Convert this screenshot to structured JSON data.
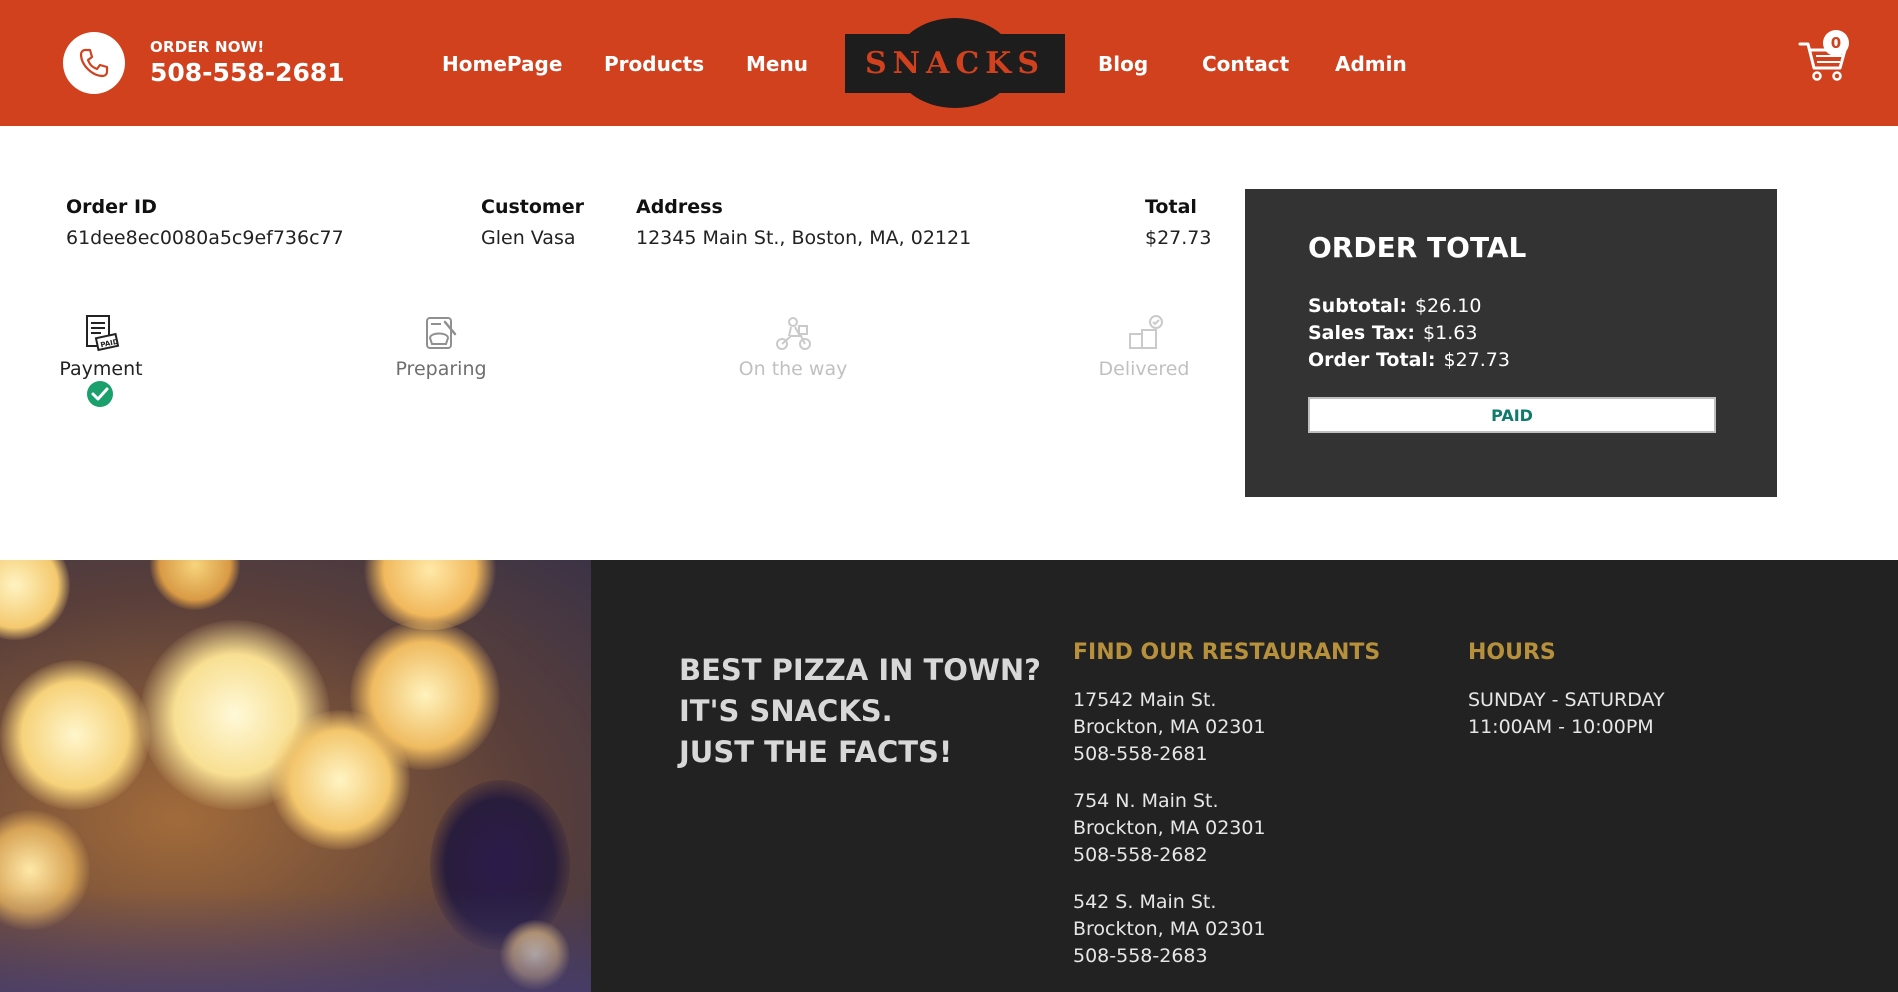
{
  "header": {
    "order_now": "ORDER NOW!",
    "phone": "508-558-2681",
    "nav_left": [
      "HomePage",
      "Products",
      "Menu"
    ],
    "logo": "SNACKS",
    "nav_right": [
      "Blog",
      "Contact",
      "Admin"
    ],
    "cart_count": "0",
    "brand_color": "#d1411e"
  },
  "order": {
    "headers": {
      "id": "Order ID",
      "customer": "Customer",
      "address": "Address",
      "total": "Total"
    },
    "id": "61dee8ec0080a5c9ef736c77",
    "customer": "Glen Vasa",
    "address": "12345 Main St., Boston, MA, 02121",
    "total": "$27.73"
  },
  "statuses": [
    {
      "label": "Payment",
      "icon": "paid-receipt-icon",
      "state": "done"
    },
    {
      "label": "Preparing",
      "icon": "chef-pot-icon",
      "state": "inprogress"
    },
    {
      "label": "On the way",
      "icon": "delivery-scooter-icon",
      "state": "undone"
    },
    {
      "label": "Delivered",
      "icon": "delivered-box-icon",
      "state": "undone"
    }
  ],
  "summary": {
    "title": "ORDER TOTAL",
    "subtotal_label": "Subtotal:",
    "subtotal": "$26.10",
    "tax_label": "Sales Tax:",
    "tax": "$1.63",
    "total_label": "Order Total:",
    "total": "$27.73",
    "status_button": "PAID"
  },
  "footer": {
    "slogan": [
      "BEST PIZZA IN TOWN?",
      "IT'S SNACKS.",
      "JUST THE FACTS!"
    ],
    "restaurants_title": "FIND OUR RESTAURANTS",
    "restaurants": [
      {
        "street": "17542 Main St.",
        "city": "Brockton, MA 02301",
        "phone": "508-558-2681"
      },
      {
        "street": "754 N. Main St.",
        "city": "Brockton, MA 02301",
        "phone": "508-558-2682"
      },
      {
        "street": "542 S. Main St.",
        "city": "Brockton, MA 02301",
        "phone": "508-558-2683"
      }
    ],
    "hours_title": "HOURS",
    "hours_days": "SUNDAY - SATURDAY",
    "hours_time": "11:00AM - 10:00PM"
  }
}
